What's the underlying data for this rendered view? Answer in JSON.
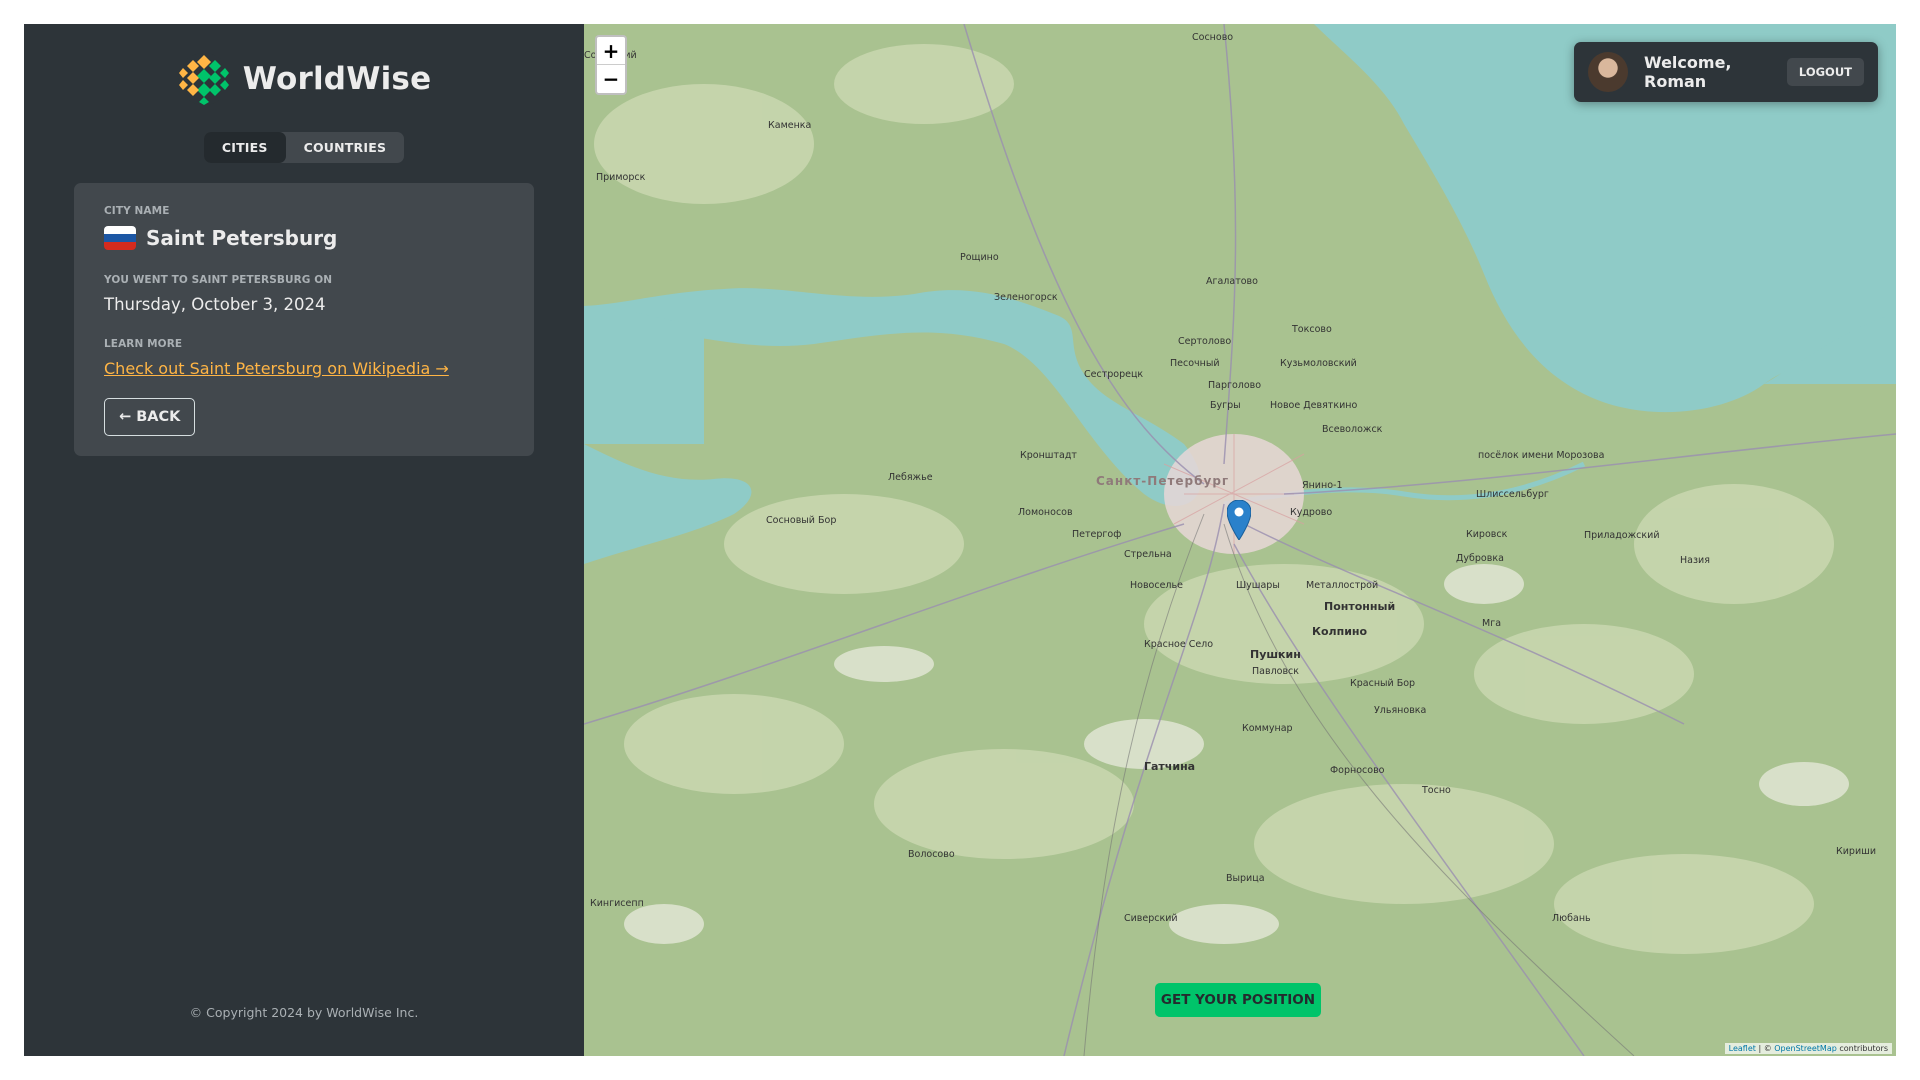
{
  "app": {
    "name": "WorldWise"
  },
  "nav": {
    "cities": "CITIES",
    "countries": "COUNTRIES"
  },
  "city": {
    "name_label": "CITY NAME",
    "name": "Saint Petersburg",
    "flag_colors": [
      "#ffffff",
      "#1c57a5",
      "#d52b1e"
    ],
    "visited_label": "YOU WENT TO SAINT PETERSBURG ON",
    "visited_date": "Thursday, October 3, 2024",
    "learn_label": "LEARN MORE",
    "wiki_link": "Check out Saint Petersburg on Wikipedia →",
    "back": "← BACK"
  },
  "footer": {
    "copyright": "© Copyright 2024 by WorldWise Inc."
  },
  "map": {
    "zoom_in": "+",
    "zoom_out": "−",
    "get_position": "GET YOUR POSITION",
    "attribution_leaflet": "Leaflet",
    "attribution_sep": " | © ",
    "attribution_osm": "OpenStreetMap",
    "attribution_contrib": " contributors",
    "places": [
      {
        "name": "Сосново"
      },
      {
        "name": "Советский"
      },
      {
        "name": "Каменка"
      },
      {
        "name": "Приморск"
      },
      {
        "name": "Рощино"
      },
      {
        "name": "Зеленогорск"
      },
      {
        "name": "Агалатово"
      },
      {
        "name": "Токсово"
      },
      {
        "name": "Сертолово"
      },
      {
        "name": "Кузьмоловский"
      },
      {
        "name": "Песочный"
      },
      {
        "name": "Сестрорецк"
      },
      {
        "name": "Парголово"
      },
      {
        "name": "Бугры"
      },
      {
        "name": "Новое Девяткино"
      },
      {
        "name": "Всеволожск"
      },
      {
        "name": "Кронштадт"
      },
      {
        "name": "Санкт-Петербург"
      },
      {
        "name": "Лебяжье"
      },
      {
        "name": "Янино-1"
      },
      {
        "name": "посёлок имени Морозова"
      },
      {
        "name": "Шлиссельбург"
      },
      {
        "name": "Ломоносов"
      },
      {
        "name": "Сосновый Бор"
      },
      {
        "name": "Кудрово"
      },
      {
        "name": "Петергоф"
      },
      {
        "name": "Кировск"
      },
      {
        "name": "Приладожский"
      },
      {
        "name": "Стрельна"
      },
      {
        "name": "Дубровка"
      },
      {
        "name": "Назия"
      },
      {
        "name": "Новоселье"
      },
      {
        "name": "Шушары"
      },
      {
        "name": "Металлострой"
      },
      {
        "name": "Понтонный"
      },
      {
        "name": "Колпино"
      },
      {
        "name": "Мга"
      },
      {
        "name": "Красное Село"
      },
      {
        "name": "Пушкин"
      },
      {
        "name": "Павловск"
      },
      {
        "name": "Красный Бор"
      },
      {
        "name": "Ульяновка"
      },
      {
        "name": "Коммунар"
      },
      {
        "name": "Гатчина"
      },
      {
        "name": "Форносово"
      },
      {
        "name": "Тосно"
      },
      {
        "name": "Волосово"
      },
      {
        "name": "Кириши"
      },
      {
        "name": "Вырица"
      },
      {
        "name": "Кингисепп"
      },
      {
        "name": "Сиверский"
      },
      {
        "name": "Любань"
      }
    ]
  },
  "user": {
    "welcome": "Welcome, Roman",
    "logout": "LOGOUT"
  }
}
